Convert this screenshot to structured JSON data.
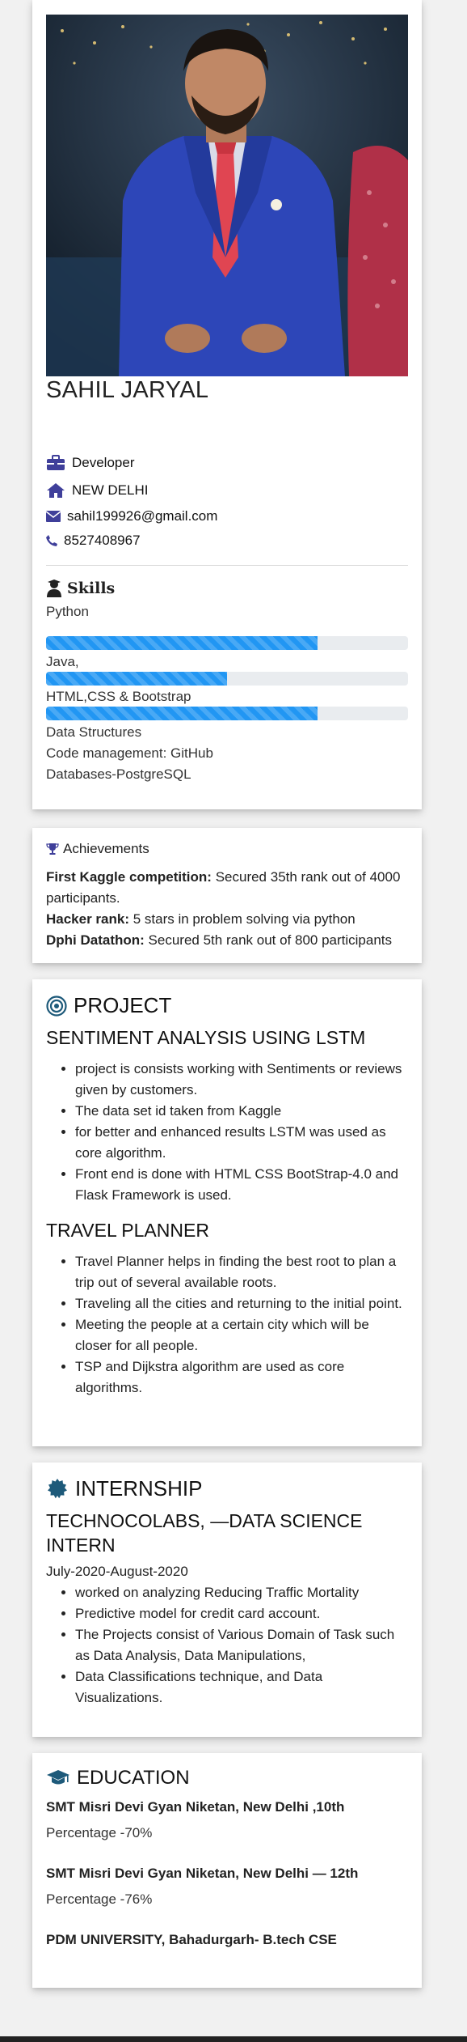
{
  "profile": {
    "name": "SAHIL JARYAL",
    "role": "Developer",
    "location": "NEW DELHI",
    "email": "sahil199926@gmail.com",
    "phone": "8527408967"
  },
  "skills": {
    "title": "Skills",
    "items": [
      {
        "label": "Python",
        "level": 0.75
      },
      {
        "label": "Java,",
        "level": 0.5
      },
      {
        "label": "HTML,CSS & Bootstrap",
        "level": 0.75
      }
    ],
    "extra": [
      "Data Structures",
      "Code management: GitHub",
      "Databases-PostgreSQL"
    ]
  },
  "achievements": {
    "title": "Achievements",
    "items": [
      {
        "label": "First Kaggle competition:",
        "text": " Secured 35th rank out of 4000 participants."
      },
      {
        "label": "Hacker rank:",
        "text": " 5 stars in problem solving via python"
      },
      {
        "label": "Dphi Datathon:",
        "text": " Secured 5th rank out of 800 participants"
      }
    ]
  },
  "project": {
    "title": "PROJECT",
    "projects": [
      {
        "name": "SENTIMENT ANALYSIS USING LSTM",
        "points": [
          "project is consists working with Sentiments or reviews given by customers.",
          "The data set id taken from Kaggle",
          "for better and enhanced results LSTM was used as core algorithm.",
          "Front end is done with HTML CSS BootStrap-4.0 and Flask Framework is used."
        ]
      },
      {
        "name": "TRAVEL PLANNER",
        "points": [
          "Travel Planner helps in finding the best root to plan a trip out of several available roots.",
          "Traveling all the cities and returning to the initial point.",
          "Meeting the people at a certain city which will be closer for all people.",
          "TSP and Dijkstra algorithm are used as core algorithms."
        ]
      }
    ]
  },
  "internship": {
    "title": "INTERNSHIP",
    "company": "TECHNOCOLABS, —DATA SCIENCE INTERN",
    "dates": "July-2020-August-2020",
    "points": [
      "worked on analyzing Reducing Traffic Mortality",
      "Predictive model for credit card account.",
      "The Projects consist of Various Domain of Task such as Data Analysis, Data Manipulations,",
      "Data Classifications technique, and Data Visualizations."
    ]
  },
  "education": {
    "title": "EDUCATION",
    "entries": [
      {
        "school": "SMT Misri Devi Gyan Niketan, New Delhi ,10th",
        "percentage": "Percentage -70%"
      },
      {
        "school": "SMT Misri Devi Gyan Niketan, New Delhi — 12th",
        "percentage": "Percentage -76%"
      },
      {
        "school": "PDM UNIVERSITY, Bahadurgarh- B.tech CSE",
        "percentage": ""
      }
    ]
  },
  "colors": {
    "accent": "#3f3f9a",
    "icon_teal": "#1e5a7a",
    "progress": "#2196f3",
    "progress_track": "#e9ecef"
  }
}
